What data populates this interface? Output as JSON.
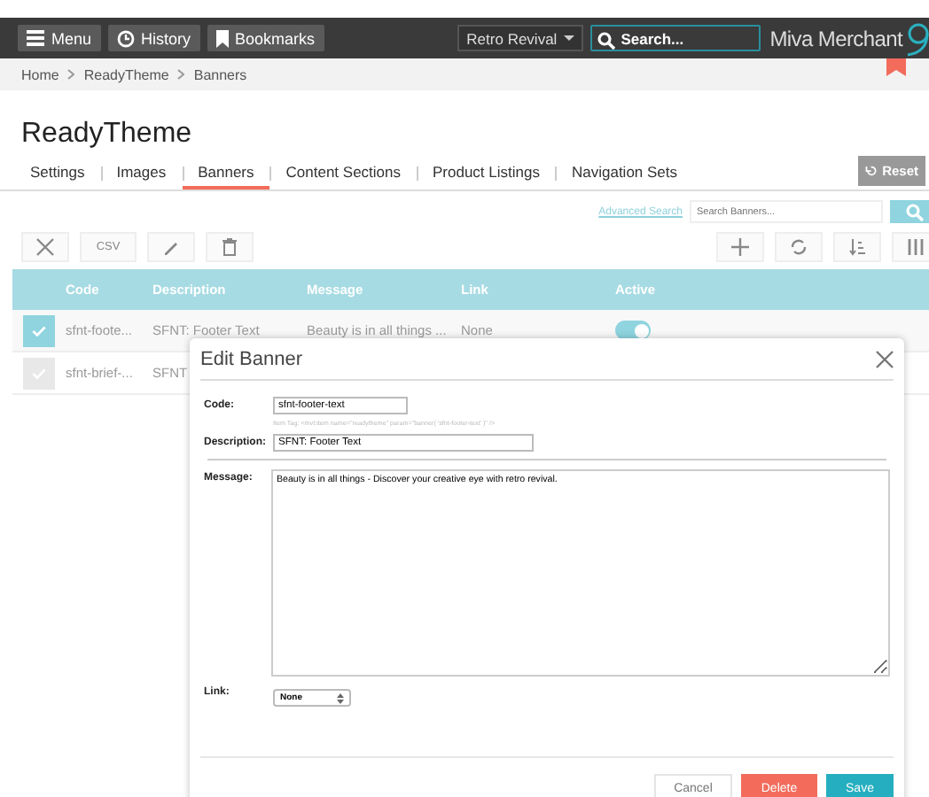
{
  "topbar": {
    "buttons": [
      {
        "kind": "menu",
        "label": "Menu"
      },
      {
        "kind": "history",
        "label": "History"
      },
      {
        "kind": "bookmarks",
        "label": "Bookmarks"
      }
    ],
    "store": "Retro Revival",
    "search": {
      "placeholder": "Search..."
    },
    "logo": "Miva Merchant"
  },
  "breadcrumbs": [
    "Home",
    "ReadyTheme",
    "Banners"
  ],
  "title": "ReadyTheme",
  "tabs": [
    {
      "label": "Settings",
      "selected": false
    },
    {
      "label": "Images",
      "selected": false
    },
    {
      "label": "Banners",
      "selected": true
    },
    {
      "label": "Content Sections",
      "selected": false
    },
    {
      "label": "Product Listings",
      "selected": false
    },
    {
      "label": "Navigation Sets",
      "selected": false
    }
  ],
  "reset": "Reset",
  "advanced_search": "Advanced Search",
  "search_banners": {
    "placeholder": "Search Banners..."
  },
  "toolbar_left": [
    {
      "kind": "clear"
    },
    {
      "kind": "text",
      "label": "CSV"
    },
    {
      "kind": "edit"
    },
    {
      "kind": "delete"
    }
  ],
  "toolbar_right": [
    {
      "kind": "add"
    },
    {
      "kind": "refresh"
    },
    {
      "kind": "sort"
    },
    {
      "kind": "columns"
    }
  ],
  "table": {
    "columns": [
      "Code",
      "Description",
      "Message",
      "Link",
      "Active"
    ],
    "rows": [
      {
        "selected": true,
        "cells": [
          "sfnt-foote...",
          "SFNT: Footer Text",
          "Beauty is in all things ...",
          "None"
        ],
        "active": true
      },
      {
        "selected": false,
        "cells": [
          "sfnt-brief-...",
          "SFNT"
        ]
      }
    ]
  },
  "dialog": {
    "title": "Edit Banner",
    "code": {
      "label": "Code:",
      "value": "sfnt-footer-text"
    },
    "item_tag": "Item Tag: <mvt:item name=\"readytheme\" param=\"banner( 'sfnt-footer-text' )\" />",
    "description": {
      "label": "Description:",
      "value": "SFNT: Footer Text"
    },
    "message": {
      "label": "Message:",
      "value": "Beauty is in all things - Discover your creative eye with retro revival."
    },
    "link": {
      "label": "Link:",
      "value": "None"
    },
    "buttons": [
      {
        "kind": "cancel",
        "label": "Cancel"
      },
      {
        "kind": "delete",
        "label": "Delete"
      },
      {
        "kind": "save",
        "label": "Save"
      }
    ]
  }
}
